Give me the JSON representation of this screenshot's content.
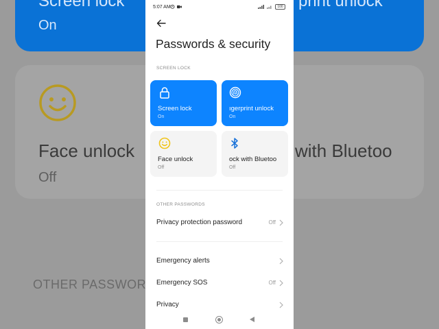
{
  "background": {
    "screen_lock_title": "Screen lock",
    "screen_lock_state": "On",
    "fingerprint_title": "print unlock",
    "face_unlock_title": "Face unlock",
    "face_unlock_state": "Off",
    "bluetooth_title": "with Bluetoo",
    "other_passwords_section": "OTHER PASSWOR"
  },
  "status_bar": {
    "time": "5:07 AM",
    "battery": "100"
  },
  "header": {
    "title": "Passwords & security"
  },
  "screen_lock_section": {
    "label": "SCREEN LOCK",
    "tiles": [
      {
        "label": "Screen lock",
        "state": "On",
        "icon": "lock-icon"
      },
      {
        "label": "ıgerprint unlock",
        "state": "On",
        "icon": "fingerprint-icon"
      },
      {
        "label": "Face unlock",
        "state": "Off",
        "icon": "face-icon"
      },
      {
        "label": "ock with Bluetoo",
        "state": "Off",
        "icon": "bluetooth-icon"
      }
    ]
  },
  "other_passwords_section": {
    "label": "OTHER PASSWORDS",
    "items": [
      {
        "label": "Privacy protection password",
        "value": "Off"
      }
    ]
  },
  "more_items": [
    {
      "label": "Emergency alerts",
      "value": ""
    },
    {
      "label": "Emergency SOS",
      "value": "Off"
    },
    {
      "label": "Privacy",
      "value": ""
    }
  ],
  "colors": {
    "accent_blue": "#0d84ff",
    "tile_grey": "#f4f4f4",
    "face_yellow": "#f0c419"
  }
}
